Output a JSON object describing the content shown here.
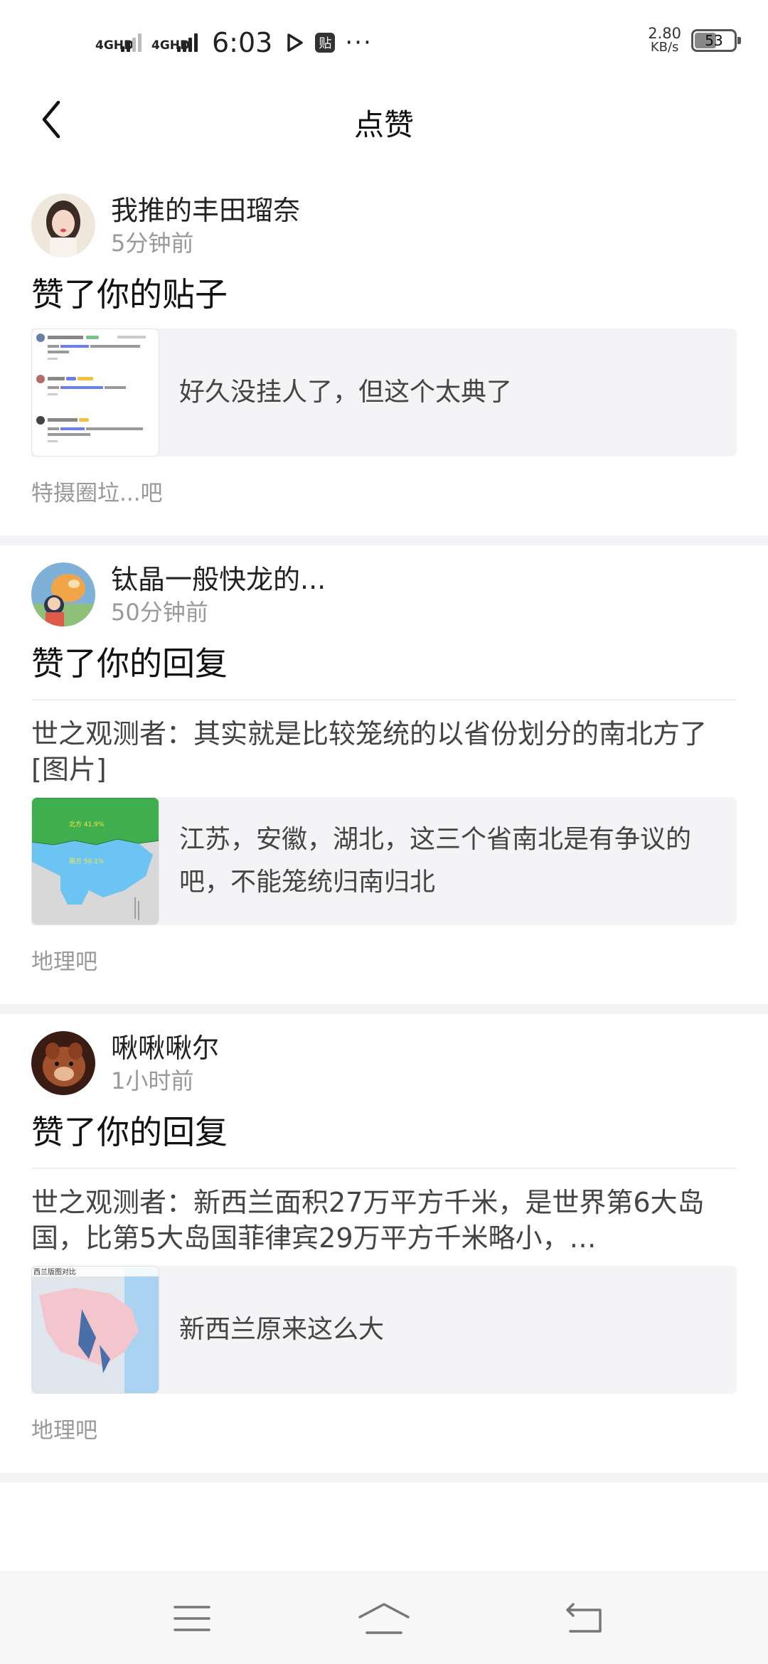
{
  "status_bar": {
    "net1": "4GHD",
    "net2": "4GHD",
    "time": "6:03",
    "app_badge": "贴",
    "more": "···",
    "speed_value": "2.80",
    "speed_unit": "KB/s",
    "battery": "53"
  },
  "header": {
    "title": "点赞"
  },
  "notifications": [
    {
      "username": "我推的丰田瑠奈",
      "time": "5分钟前",
      "action": "赞了你的贴子",
      "quote": "",
      "post_text": "好久没挂人了，但这个太典了",
      "forum": "特摄圈垃...吧"
    },
    {
      "username": "钛晶一般快龙的...",
      "time": "50分钟前",
      "action": "赞了你的回复",
      "quote": "世之观测者：其实就是比较笼统的以省份划分的南北方了[图片]",
      "post_text": "江苏，安徽，湖北，这三个省南北是有争议的吧，不能笼统归南归北",
      "forum": "地理吧"
    },
    {
      "username": "啾啾啾尔",
      "time": "1小时前",
      "action": "赞了你的回复",
      "quote": "世之观测者：新西兰面积27万平方千米，是世界第6大岛国，比第5大岛国菲律宾29万平方千米略小，…",
      "post_text": "新西兰原来这么大",
      "forum": "地理吧"
    }
  ],
  "thumbnails": {
    "map_label_north": "北方 41.9%",
    "map_label_south": "南方 58.1%",
    "nz_title": "西兰版图对比"
  },
  "colors": {
    "accent_blue": "#4a6cf7",
    "muted_text": "#999999",
    "box_bg": "#f4f4f6"
  }
}
